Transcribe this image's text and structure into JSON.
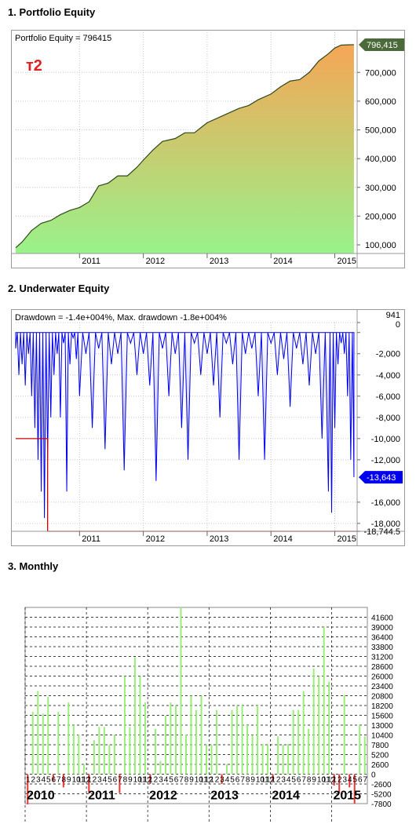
{
  "sections": {
    "equity_title": "1. Portfolio Equity",
    "underwater_title": "2. Underwater Equity",
    "monthly_title": "3. Monthly"
  },
  "colors": {
    "equity_fill_top": "#f5a656",
    "equity_fill_bottom": "#99f28a",
    "equity_line": "#2e4a1e",
    "equity_badge": "#4a6a3a",
    "tag_red": "#e02020",
    "underwater": "#0000ee",
    "maxdd_line": "#cc0000",
    "monthly_pos": "#99ee77",
    "monthly_neg": "#ee3333"
  },
  "chart_data": [
    {
      "type": "area",
      "title": "Portfolio Equity = 796415",
      "tag": "т2",
      "last_value_label": "796,415",
      "x_ticks": [
        "2011",
        "2012",
        "2013",
        "2014",
        "2015"
      ],
      "y_ticks": [
        "100,000",
        "200,000",
        "300,000",
        "400,000",
        "500,000",
        "600,000",
        "700,000"
      ],
      "ylim": [
        70000,
        840000
      ],
      "grid": true,
      "series": [
        {
          "x": [
            2010.0,
            2010.1,
            2010.25,
            2010.4,
            2010.55,
            2010.7,
            2010.85,
            2011.0,
            2011.15,
            2011.3,
            2011.45,
            2011.6,
            2011.75,
            2011.9,
            2012.0,
            2012.15,
            2012.3,
            2012.5,
            2012.65,
            2012.8,
            2013.0,
            2013.2,
            2013.35,
            2013.5,
            2013.65,
            2013.8,
            2014.0,
            2014.15,
            2014.3,
            2014.45,
            2014.6,
            2014.75,
            2014.9,
            2015.0,
            2015.1,
            2015.2,
            2015.3
          ],
          "values": [
            90000,
            110000,
            150000,
            175000,
            185000,
            205000,
            220000,
            230000,
            250000,
            305000,
            315000,
            340000,
            340000,
            370000,
            395000,
            430000,
            460000,
            470000,
            490000,
            490000,
            525000,
            545000,
            560000,
            575000,
            585000,
            605000,
            625000,
            650000,
            670000,
            675000,
            700000,
            740000,
            765000,
            785000,
            795000,
            796000,
            796415
          ]
        }
      ]
    },
    {
      "type": "area",
      "title": "Drawdown = -1.4e+004%, Max. drawdown -1.8e+004%",
      "last_value_label": "-13,643",
      "x_ticks": [
        "2011",
        "2012",
        "2013",
        "2014",
        "2015"
      ],
      "y_ticks": [
        "941",
        "0",
        "-2,000",
        "-4,000",
        "-6,000",
        "-8,000",
        "-10,000",
        "-12,000",
        "-16,000",
        "-18,000",
        "-18,744.5"
      ],
      "ylim": [
        -18744.5,
        941
      ],
      "grid": true,
      "max_drawdown_steps": {
        "x": [
          2010.0,
          2010.4,
          2010.5,
          2015.35
        ],
        "values": [
          -10000,
          -10000,
          -18744.5,
          -18744.5
        ]
      },
      "series": [
        {
          "x": [
            2010.0,
            2010.05,
            2010.1,
            2010.15,
            2010.2,
            2010.25,
            2010.3,
            2010.35,
            2010.4,
            2010.45,
            2010.5,
            2010.55,
            2010.6,
            2010.65,
            2010.7,
            2010.75,
            2010.8,
            2010.85,
            2010.9,
            2010.95,
            2011.0,
            2011.1,
            2011.2,
            2011.3,
            2011.4,
            2011.5,
            2011.6,
            2011.7,
            2011.8,
            2011.9,
            2012.0,
            2012.1,
            2012.2,
            2012.3,
            2012.4,
            2012.5,
            2012.6,
            2012.7,
            2012.8,
            2012.9,
            2013.0,
            2013.1,
            2013.2,
            2013.3,
            2013.4,
            2013.5,
            2013.6,
            2013.7,
            2013.8,
            2013.9,
            2014.0,
            2014.1,
            2014.2,
            2014.3,
            2014.4,
            2014.5,
            2014.6,
            2014.7,
            2014.8,
            2014.9,
            2014.95,
            2015.0,
            2015.05,
            2015.1,
            2015.15,
            2015.2,
            2015.25,
            2015.3
          ],
          "values": [
            -1500,
            -4000,
            -3000,
            -5000,
            -2000,
            -6000,
            -9000,
            -12000,
            -15000,
            -17500,
            -12000,
            -8000,
            -4000,
            -2000,
            -8000,
            -1000,
            -15000,
            -3000,
            -500,
            -2500,
            -6000,
            -2000,
            -9000,
            -1500,
            -11000,
            -3000,
            -2000,
            -13000,
            -1000,
            -4000,
            -2000,
            -5000,
            -14000,
            -1500,
            -6000,
            -2000,
            -9000,
            -12000,
            -1000,
            -4000,
            -2000,
            -5000,
            -8000,
            -1000,
            -3000,
            -12000,
            -2000,
            -1500,
            -6000,
            -12000,
            -1000,
            -4000,
            -2500,
            -7000,
            -1500,
            -3000,
            -5000,
            -2000,
            -10000,
            -15000,
            -17000,
            -9000,
            -3000,
            -1000,
            -2000,
            -6000,
            -12000,
            -13643
          ]
        }
      ]
    },
    {
      "type": "bar",
      "title": "",
      "month_labels": [
        "1",
        "2",
        "3",
        "4",
        "5",
        "6",
        "7",
        "8",
        "9",
        "10",
        "11",
        "12"
      ],
      "years": [
        "2010",
        "2011",
        "2012",
        "2013",
        "2014",
        "2015"
      ],
      "y_ticks": [
        "41600",
        "39000",
        "36400",
        "33800",
        "31200",
        "28600",
        "26000",
        "23400",
        "20800",
        "18200",
        "15600",
        "13000",
        "10400",
        "7800",
        "5200",
        "2600",
        "0",
        "-2600",
        "-5200",
        "-7800"
      ],
      "ylim": [
        -7800,
        44200
      ],
      "grid": true,
      "series": [
        {
          "name": "",
          "values": [
            -8000,
            16500,
            22000,
            16000,
            20500,
            -2000,
            16500,
            -3500,
            19000,
            13000,
            10500,
            2600,
            -5000,
            9000,
            12500,
            12500,
            7800,
            10500,
            -5000,
            26000,
            12500,
            31000,
            26000,
            19000,
            -2600,
            12000,
            3500,
            15500,
            19000,
            18200,
            44200,
            10500,
            20800,
            17000,
            20800,
            7800,
            7800,
            17000,
            -2600,
            2600,
            17000,
            18200,
            18200,
            13000,
            10400,
            18200,
            8000,
            7800,
            -1800,
            10000,
            7800,
            8000,
            17000,
            17000,
            22000,
            12000,
            28000,
            26000,
            39000,
            24500,
            -3000,
            -5000,
            21000,
            -3500,
            -7800,
            13000,
            10000
          ]
        }
      ]
    }
  ]
}
